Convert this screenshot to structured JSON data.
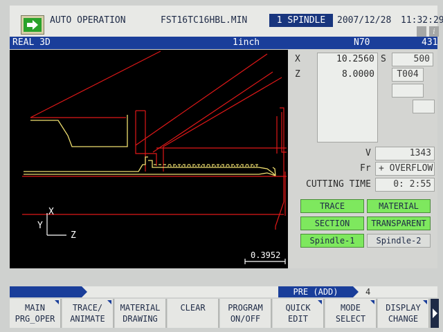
{
  "topbar": {
    "mode": "AUTO OPERATION",
    "program": "FST16TC16HBL.MIN",
    "spindle": "1 SPINDLE",
    "date": "2007/12/28",
    "time": "11:32:29",
    "info_glyph": "i",
    "icons": [
      "go-arrow-icon",
      "document-icon",
      "info-icon"
    ]
  },
  "view": {
    "name": "REAL 3D",
    "unit": "1inch",
    "n_number": "N70",
    "line": "431"
  },
  "graphic": {
    "scale": "0.3952",
    "axis_x": "X",
    "axis_y": "Y",
    "axis_z": "Z"
  },
  "position": {
    "x_label": "X",
    "x_value": "10.2560",
    "z_label": "Z",
    "z_value": "8.0000",
    "s_label": "S",
    "s_value": "500",
    "tool": "T004",
    "v_label": "V",
    "v_value": "1343",
    "fr_label": "Fr",
    "fr_value": "+ OVERFLOW",
    "cutting_time_label": "CUTTING TIME",
    "cutting_time_value": "0: 2:55"
  },
  "toggles": [
    {
      "label": "TRACE",
      "active": true
    },
    {
      "label": "MATERIAL",
      "active": true
    },
    {
      "label": "SECTION",
      "active": true
    },
    {
      "label": "TRANSPARENT",
      "active": true
    },
    {
      "label": "Spindle-1",
      "active": true
    },
    {
      "label": "Spindle-2",
      "active": false
    }
  ],
  "pre_bar": {
    "label": "PRE (ADD)",
    "value": "4"
  },
  "softkeys": [
    {
      "line1": "MAIN",
      "line2": "PRG_OPER",
      "has_submenu": true
    },
    {
      "line1": "TRACE/",
      "line2": "ANIMATE",
      "has_submenu": true
    },
    {
      "line1": "MATERIAL",
      "line2": "DRAWING",
      "has_submenu": false
    },
    {
      "line1": "CLEAR",
      "line2": "",
      "has_submenu": false
    },
    {
      "line1": "PROGRAM",
      "line2": "ON/OFF",
      "has_submenu": false
    },
    {
      "line1": "QUICK",
      "line2": "EDIT",
      "has_submenu": true
    },
    {
      "line1": "MODE",
      "line2": "SELECT",
      "has_submenu": true
    },
    {
      "line1": "DISPLAY",
      "line2": "CHANGE",
      "has_submenu": true
    }
  ],
  "colors": {
    "header_blue": "#1a3e9a",
    "active_green": "#7ee85e",
    "toolpath_red": "#e01818",
    "part_yellow": "#f0e070",
    "axis_white": "#ffffff"
  }
}
